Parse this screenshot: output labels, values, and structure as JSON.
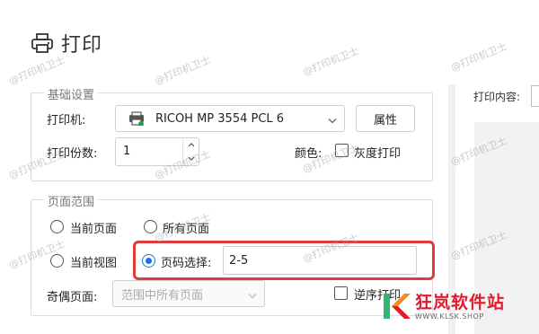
{
  "dialog": {
    "title": "打印"
  },
  "basic_settings": {
    "group_title": "基础设置",
    "printer_label": "打印机:",
    "printer_value": "RICOH MP 3554 PCL 6",
    "properties_button": "属性",
    "copies_label": "打印份数:",
    "copies_value": "1",
    "color_label": "颜色:",
    "grayscale_label": "灰度打印",
    "grayscale_checked": false
  },
  "page_range": {
    "group_title": "页面范围",
    "current_page": "当前页面",
    "all_pages": "所有页面",
    "current_view": "当前视图",
    "page_select_label": "页码选择:",
    "page_select_value": "2-5",
    "selected_option": "page_select",
    "odd_even_label": "奇偶页面:",
    "odd_even_value": "范围中所有页面",
    "reverse_label": "逆序打印"
  },
  "right_panel": {
    "print_content_label": "打印内容:"
  },
  "watermark": {
    "text": "@打印机卫士"
  },
  "logo": {
    "name": "狂岚软件站",
    "url": "WWW.KLSK.SHOP"
  },
  "colors": {
    "accent": "#1a73e8",
    "highlight": "#e23b3b",
    "brand": "#e21a2c"
  }
}
